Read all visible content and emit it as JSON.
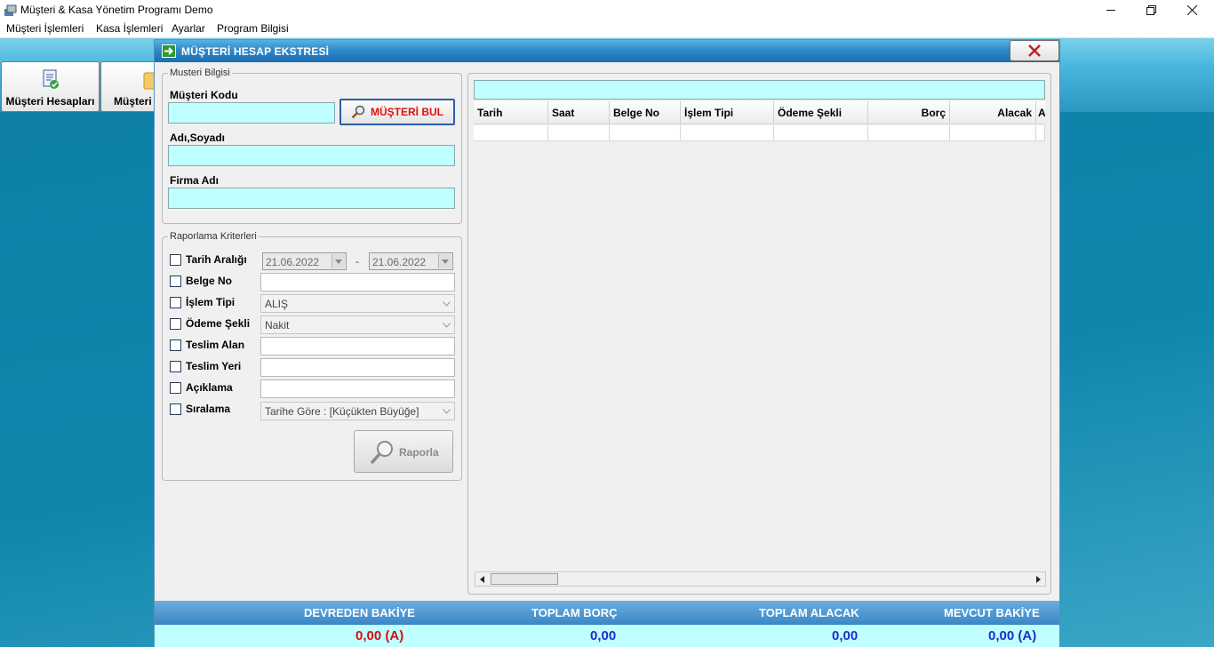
{
  "window": {
    "title": "Müşteri & Kasa Yönetim Programı Demo"
  },
  "menu": {
    "items": [
      "Müşteri İşlemleri",
      "Kasa İşlemleri",
      "Ayarlar",
      "Program Bilgisi"
    ]
  },
  "toolbar": {
    "btn_accounts": "Müşteri Hesapları",
    "btn_customer_partial": "Müşteri"
  },
  "dialog": {
    "title": "MÜŞTERİ HESAP EKSTRESİ",
    "customer_group": {
      "legend": "Musteri Bilgisi",
      "code_label": "Müşteri Kodu",
      "code_value": "",
      "find_button": "MÜŞTERİ BUL",
      "name_label": "Adı,Soyadı",
      "name_value": "",
      "company_label": "Firma Adı",
      "company_value": ""
    },
    "criteria_group": {
      "legend": "Raporlama Kriterleri",
      "date_range_label": "Tarih Aralığı",
      "date_from": "21.06.2022",
      "date_sep": "-",
      "date_to": "21.06.2022",
      "doc_no_label": "Belge No",
      "doc_no_value": "",
      "txn_type_label": "İşlem Tipi",
      "txn_type_value": "ALIŞ",
      "payment_label": "Ödeme Şekli",
      "payment_value": "Nakit",
      "receiver_label": "Teslim Alan",
      "receiver_value": "",
      "place_label": "Teslim Yeri",
      "place_value": "",
      "desc_label": "Açıklama",
      "desc_value": "",
      "sort_label": "Sıralama",
      "sort_value": "Tarihe Göre : [Küçükten Büyüğe]",
      "report_button": "Raporla"
    },
    "grid": {
      "search_value": "",
      "columns": [
        "Tarih",
        "Saat",
        "Belge No",
        "İşlem Tipi",
        "Ödeme Şekli",
        "Borç",
        "Alacak",
        "A"
      ]
    },
    "totals": {
      "carry_label": "DEVREDEN BAKİYE",
      "carry_value": "0,00",
      "carry_suffix": "(A)",
      "debit_label": "TOPLAM BORÇ",
      "debit_value": "0,00",
      "credit_label": "TOPLAM ALACAK",
      "credit_value": "0,00",
      "balance_label": "MEVCUT BAKİYE",
      "balance_value": "0,00",
      "balance_suffix": "(A)"
    }
  },
  "colors": {
    "field_cyan": "#c0ffff",
    "carry_red": "#d01010",
    "total_blue": "#1a2fc8"
  }
}
